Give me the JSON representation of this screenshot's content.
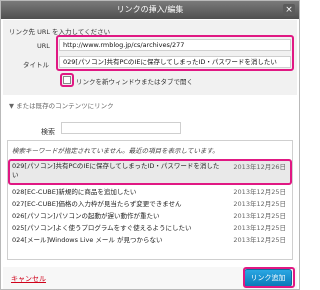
{
  "dialog": {
    "title": "リンクの挿入/編集",
    "close_icon": "close-icon"
  },
  "form": {
    "hint": "リンク先 URL を入力してください",
    "url_label": "URL",
    "url_value": "http://www.rmblog.jp/cs/archives/277",
    "title_label": "タイトル",
    "title_value": "029[パソコン]共有PCのIEに保存してしまったID・パスワードを消したい",
    "new_tab_label": "リンクを新ウィンドウまたはタブで開く",
    "new_tab_checked": false
  },
  "existing": {
    "toggle_label": "▼ または既存のコンテンツにリンク",
    "search_label": "検索",
    "search_value": "",
    "no_results": "検索キーワードが指定されていません。最近の項目を表示しています。",
    "items": [
      {
        "title": "029[パソコン]共有PCのIEに保存してしまったID・パスワードを消したい",
        "date": "2013年12月26日"
      },
      {
        "title": "028[EC-CUBE]新規的に商品を追加したい",
        "date": "2013年12月25日"
      },
      {
        "title": "027[EC-CUBE]価格の入力枠が見当たらず変更できません",
        "date": "2013年12月25日"
      },
      {
        "title": "026[パソコン]パソコンの起動が遅い動作が重たい",
        "date": "2013年12月25日"
      },
      {
        "title": "025[パソコン]よく使うプログラムをすぐ使えるようにしたい",
        "date": "2013年12月25日"
      },
      {
        "title": "024[メール]Windows Live メール が見つからない",
        "date": "2013年12月25日"
      }
    ]
  },
  "footer": {
    "cancel_label": "キャンセル",
    "submit_label": "リンク追加"
  },
  "colors": {
    "highlight": "#e01883",
    "accent": "#0a7ab9",
    "cancel": "#d0021b"
  }
}
